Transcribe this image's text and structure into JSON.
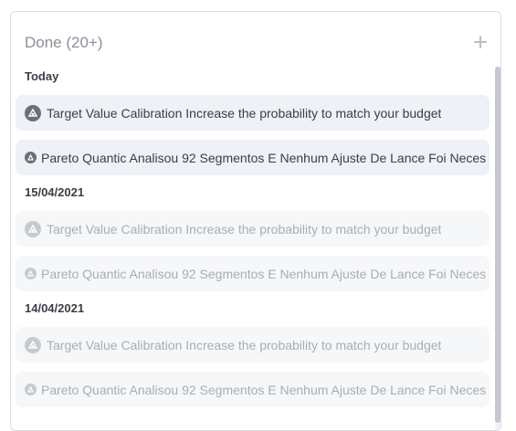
{
  "column": {
    "title": "Done (20+)"
  },
  "groups": [
    {
      "date": "Today",
      "items": [
        {
          "text": "Target Value Calibration Increase the probability to match your budget",
          "icon": "target-value-icon",
          "faded": false
        },
        {
          "text": "Pareto Quantic Analisou 92 Segmentos E Nenhum Ajuste De Lance Foi Neces",
          "icon": "pareto-icon",
          "faded": false
        }
      ]
    },
    {
      "date": "15/04/2021",
      "items": [
        {
          "text": "Target Value Calibration Increase the probability to match your budget",
          "icon": "target-value-icon",
          "faded": true
        },
        {
          "text": "Pareto Quantic Analisou 92 Segmentos E Nenhum Ajuste De Lance Foi Neces",
          "icon": "pareto-icon",
          "faded": true
        }
      ]
    },
    {
      "date": "14/04/2021",
      "items": [
        {
          "text": "Target Value Calibration Increase the probability to match your budget",
          "icon": "target-value-icon",
          "faded": true
        },
        {
          "text": "Pareto Quantic Analisou 92 Segmentos E Nenhum Ajuste De Lance Foi Neces",
          "icon": "pareto-icon",
          "faded": true
        }
      ]
    }
  ],
  "colors": {
    "item_bg": "#eef1f5",
    "item_bg_faded": "#f6f7f9",
    "text": "#3a3f47",
    "text_faded": "#a8adb5",
    "header": "#8a9099"
  }
}
